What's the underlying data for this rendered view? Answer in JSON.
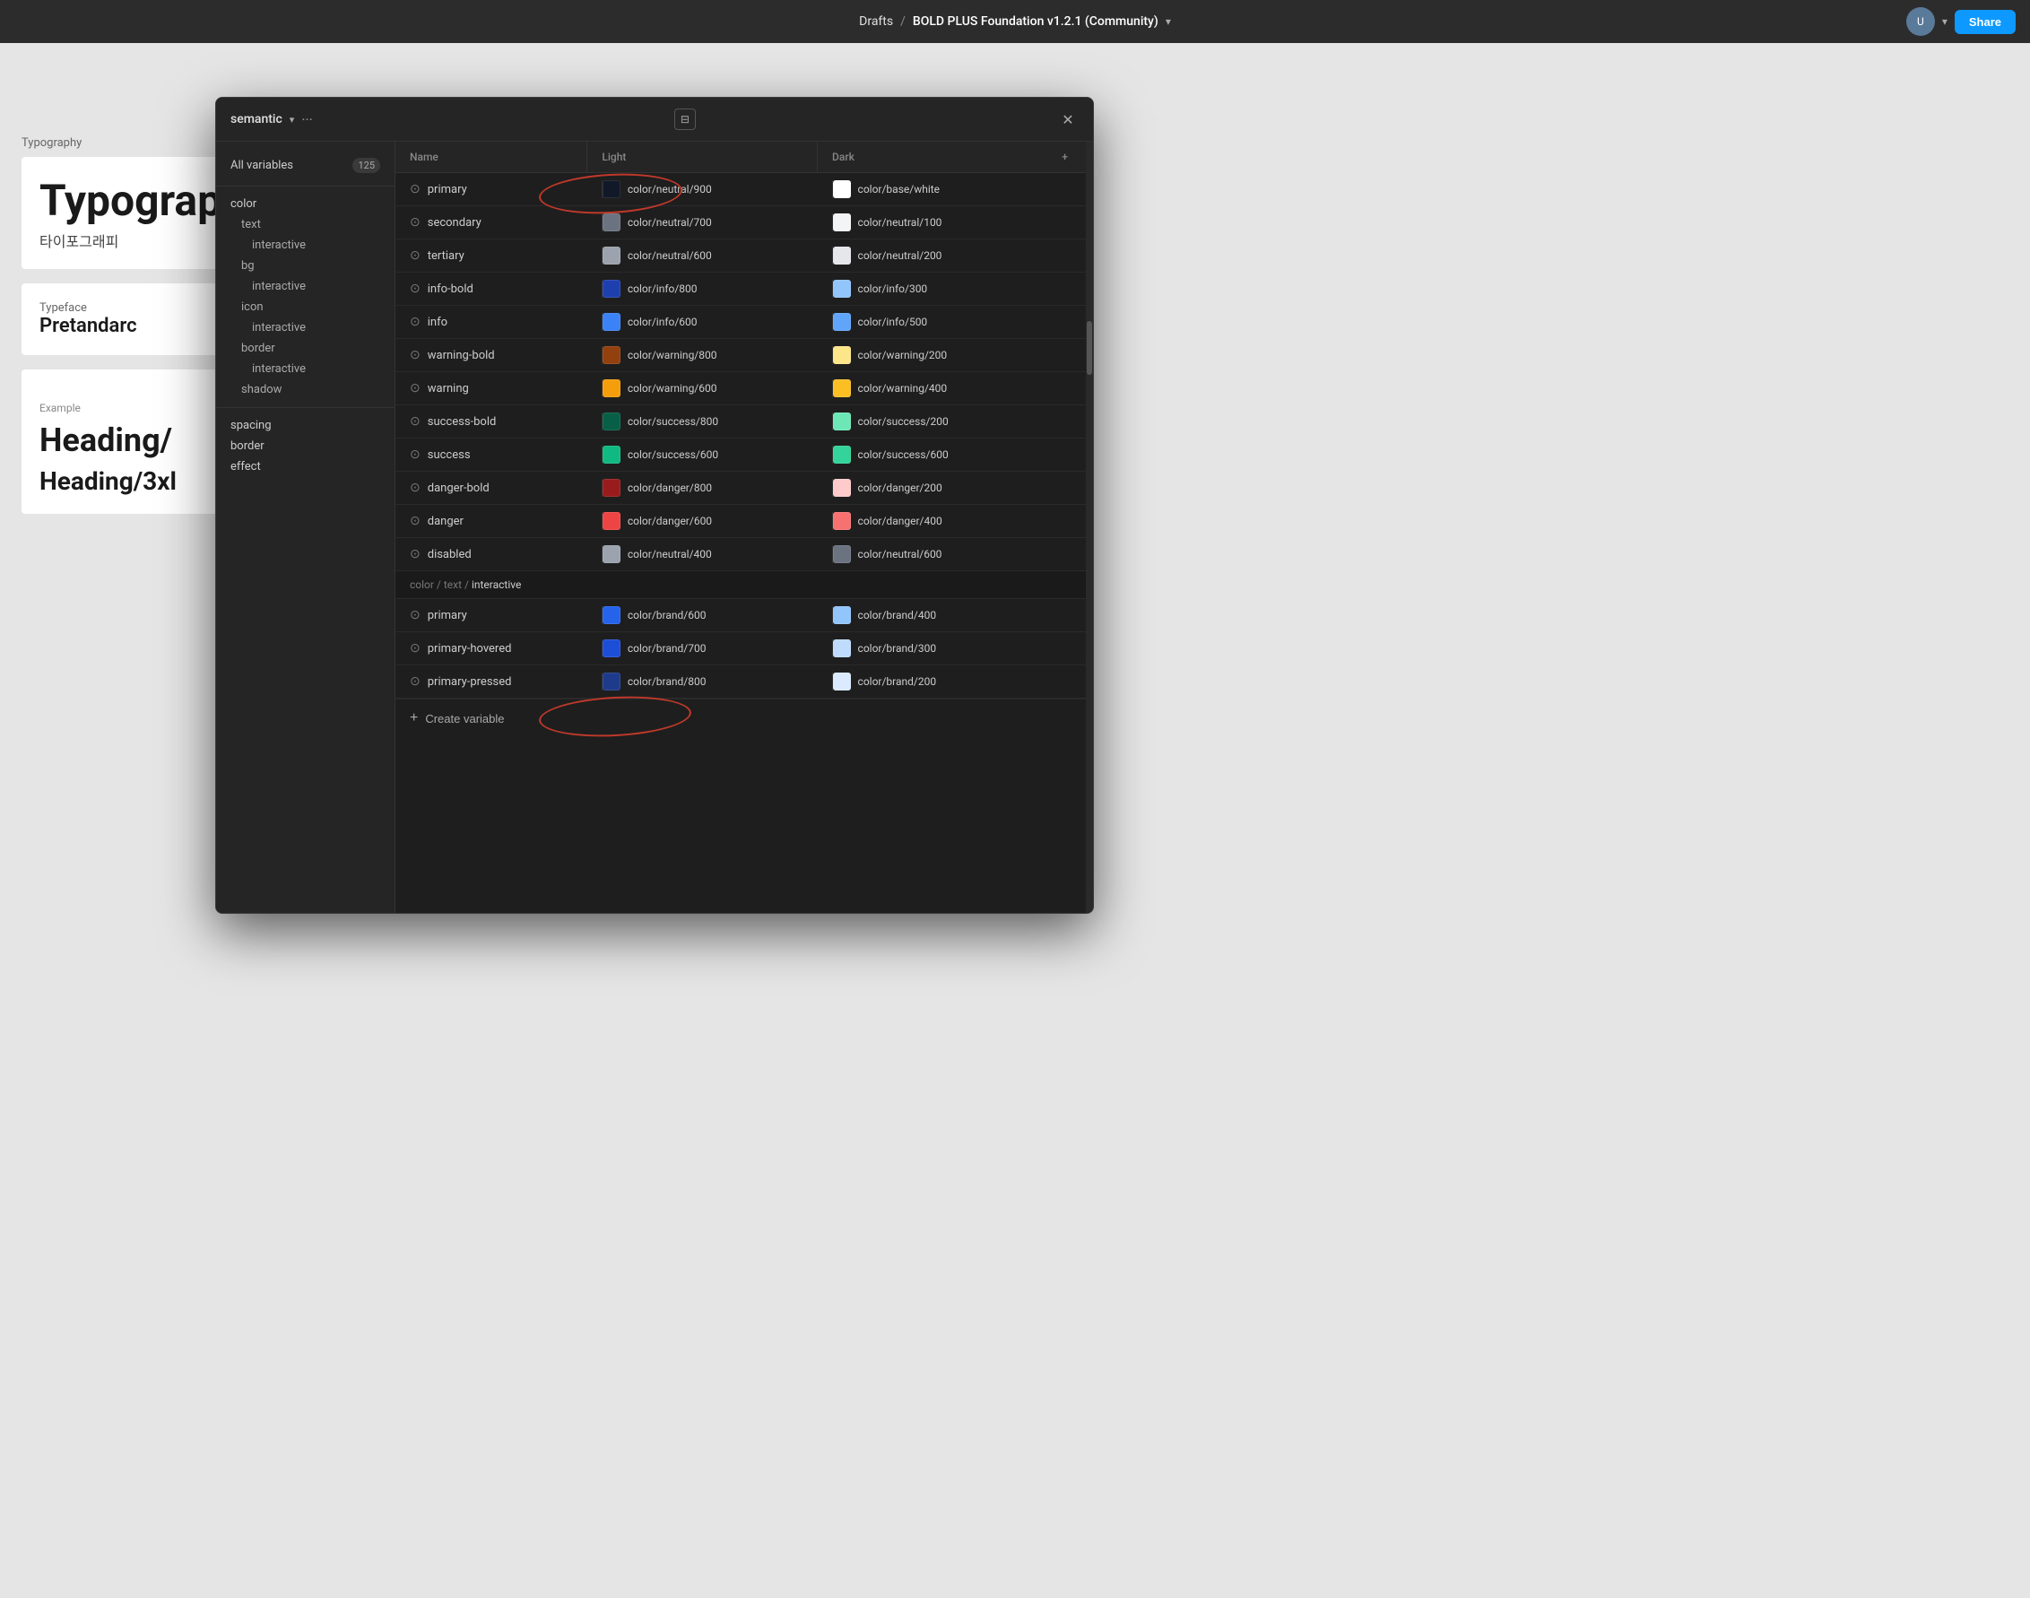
{
  "topbar": {
    "drafts": "Drafts",
    "separator": "/",
    "project": "BOLD PLUS Foundation v1.2.1 (Community)",
    "share_label": "Share"
  },
  "typography_bg": {
    "label": "Typography",
    "title": "Typograph",
    "subtitle": "타이포그래피",
    "typeface_label": "Typeface",
    "typeface_value": "Pretandarc",
    "example_label": "Example",
    "heading_large": "Heading/",
    "heading_medium": "Heading/3xl"
  },
  "modal": {
    "collection_name": "semantic",
    "panel_icon": "⊟",
    "close_icon": "✕",
    "three_dots": "···",
    "sidebar": {
      "all_vars_label": "All variables",
      "all_vars_count": "125",
      "groups": [
        {
          "name": "color",
          "children": [
            {
              "name": "text",
              "children": [
                {
                  "name": "interactive"
                }
              ]
            },
            {
              "name": "bg",
              "children": [
                {
                  "name": "interactive"
                }
              ]
            },
            {
              "name": "icon",
              "children": [
                {
                  "name": "interactive"
                }
              ]
            },
            {
              "name": "border",
              "children": [
                {
                  "name": "interactive"
                }
              ]
            },
            {
              "name": "shadow"
            }
          ]
        },
        {
          "name": "spacing"
        },
        {
          "name": "border"
        },
        {
          "name": "effect"
        }
      ]
    },
    "table": {
      "col_name": "Name",
      "col_light": "Light",
      "col_dark": "Dark",
      "col_add": "+"
    },
    "rows": [
      {
        "name": "primary",
        "light_color": "#111827",
        "light_label": "color/neutral/900",
        "dark_color": "#ffffff",
        "dark_label": "color/base/white",
        "annotation": "primary_circle"
      },
      {
        "name": "secondary",
        "light_color": "#6b7280",
        "light_label": "color/neutral/700",
        "dark_color": "#f3f4f6",
        "dark_label": "color/neutral/100"
      },
      {
        "name": "tertiary",
        "light_color": "#9ca3af",
        "light_label": "color/neutral/600",
        "dark_color": "#e5e7eb",
        "dark_label": "color/neutral/200"
      },
      {
        "name": "info-bold",
        "light_color": "#1e40af",
        "light_label": "color/info/800",
        "dark_color": "#93c5fd",
        "dark_label": "color/info/300"
      },
      {
        "name": "info",
        "light_color": "#3b82f6",
        "light_label": "color/info/600",
        "dark_color": "#60a5fa",
        "dark_label": "color/info/500"
      },
      {
        "name": "warning-bold",
        "light_color": "#92400e",
        "light_label": "color/warning/800",
        "dark_color": "#fde68a",
        "dark_label": "color/warning/200"
      },
      {
        "name": "warning",
        "light_color": "#f59e0b",
        "light_label": "color/warning/600",
        "dark_color": "#fbbf24",
        "dark_label": "color/warning/400"
      },
      {
        "name": "success-bold",
        "light_color": "#065f46",
        "light_label": "color/success/800",
        "dark_color": "#6ee7b7",
        "dark_label": "color/success/200"
      },
      {
        "name": "success",
        "light_color": "#10b981",
        "light_label": "color/success/600",
        "dark_color": "#34d399",
        "dark_label": "color/success/600"
      },
      {
        "name": "danger-bold",
        "light_color": "#991b1b",
        "light_label": "color/danger/800",
        "dark_color": "#fecaca",
        "dark_label": "color/danger/200"
      },
      {
        "name": "danger",
        "light_color": "#ef4444",
        "light_label": "color/danger/600",
        "dark_color": "#f87171",
        "dark_label": "color/danger/400"
      },
      {
        "name": "disabled",
        "light_color": "#9ca3af",
        "light_label": "color/neutral/400",
        "dark_color": "#6b7280",
        "dark_label": "color/neutral/600"
      }
    ],
    "section_interactive": {
      "path_prefix": "color / text / ",
      "path_highlight": "interactive"
    },
    "interactive_rows": [
      {
        "name": "primary",
        "light_color": "#2563eb",
        "light_label": "color/brand/600",
        "dark_color": "#93c5fd",
        "dark_label": "color/brand/400",
        "annotation": "interactive_circle"
      },
      {
        "name": "primary-hovered",
        "light_color": "#1d4ed8",
        "light_label": "color/brand/700",
        "dark_color": "#bfdbfe",
        "dark_label": "color/brand/300"
      },
      {
        "name": "primary-pressed",
        "light_color": "#1e3a8a",
        "light_label": "color/brand/800",
        "dark_color": "#dbeafe",
        "dark_label": "color/brand/200"
      }
    ],
    "create_variable_label": "Create variable"
  }
}
